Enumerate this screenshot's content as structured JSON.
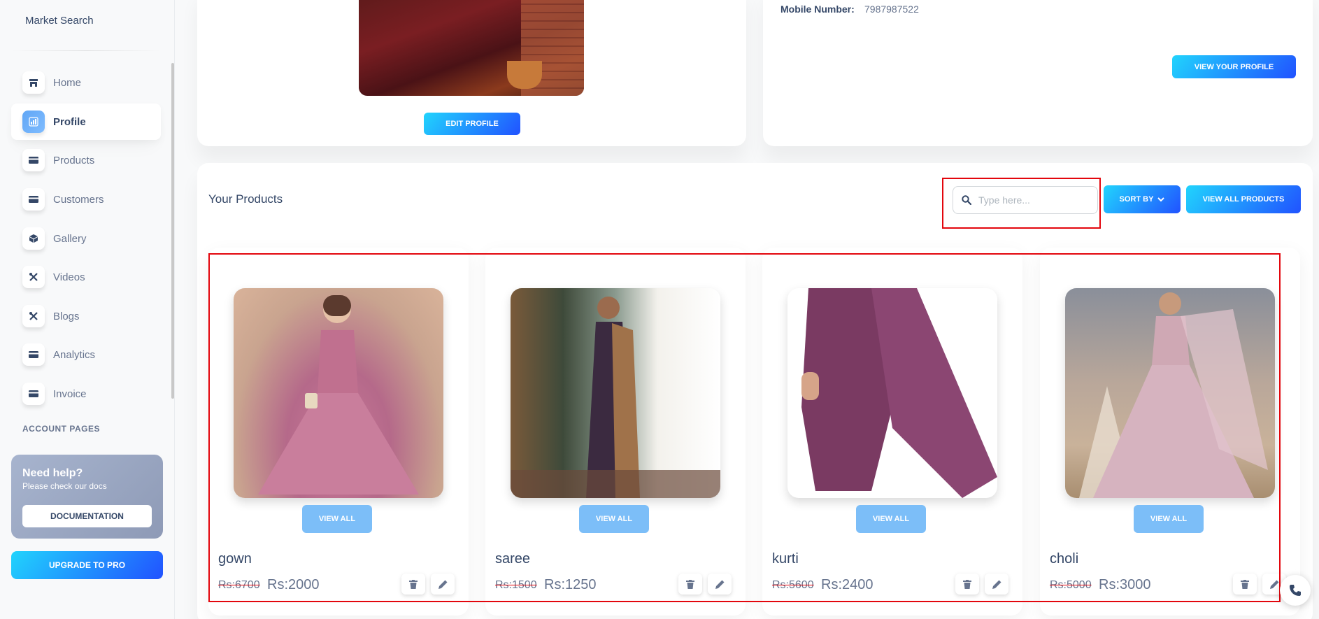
{
  "sidebar": {
    "brand": "Market Search",
    "items": [
      {
        "label": "Home",
        "icon": "shop-icon"
      },
      {
        "label": "Profile",
        "icon": "chart-icon"
      },
      {
        "label": "Products",
        "icon": "card-icon"
      },
      {
        "label": "Customers",
        "icon": "card-icon"
      },
      {
        "label": "Gallery",
        "icon": "box-icon"
      },
      {
        "label": "Videos",
        "icon": "tools-icon"
      },
      {
        "label": "Blogs",
        "icon": "tools-icon"
      },
      {
        "label": "Analytics",
        "icon": "card-icon"
      },
      {
        "label": "Invoice",
        "icon": "card-icon"
      }
    ],
    "active_item": "Profile",
    "section_title": "ACCOUNT PAGES",
    "help": {
      "title": "Need help?",
      "subtitle": "Please check our docs",
      "button": "DOCUMENTATION"
    },
    "upgrade_button": "UPGRADE TO PRO"
  },
  "profile": {
    "edit_button": "EDIT PROFILE",
    "mobile_label": "Mobile Number:",
    "mobile_value": "7987987522",
    "view_profile_button": "VIEW YOUR PROFILE"
  },
  "products": {
    "title": "Your Products",
    "search_placeholder": "Type here...",
    "sort_button": "SORT BY",
    "view_all_products_button": "VIEW ALL PRODUCTS",
    "view_all_label": "VIEW ALL",
    "items": [
      {
        "name": "gown",
        "old_price": "Rs:6700",
        "price": "Rs:2000"
      },
      {
        "name": "saree",
        "old_price": "Rs:1500",
        "price": "Rs:1250"
      },
      {
        "name": "kurti",
        "old_price": "Rs:5600",
        "price": "Rs:2400"
      },
      {
        "name": "choli",
        "old_price": "Rs:5000",
        "price": "Rs:3000"
      }
    ]
  },
  "colors": {
    "accent_gradient_start": "#2152ff",
    "accent_gradient_end": "#21d4fd",
    "view_all_button": "#7cbef8",
    "highlight": "#e3060d",
    "text_dark": "#344767",
    "text_muted": "#67748e"
  }
}
